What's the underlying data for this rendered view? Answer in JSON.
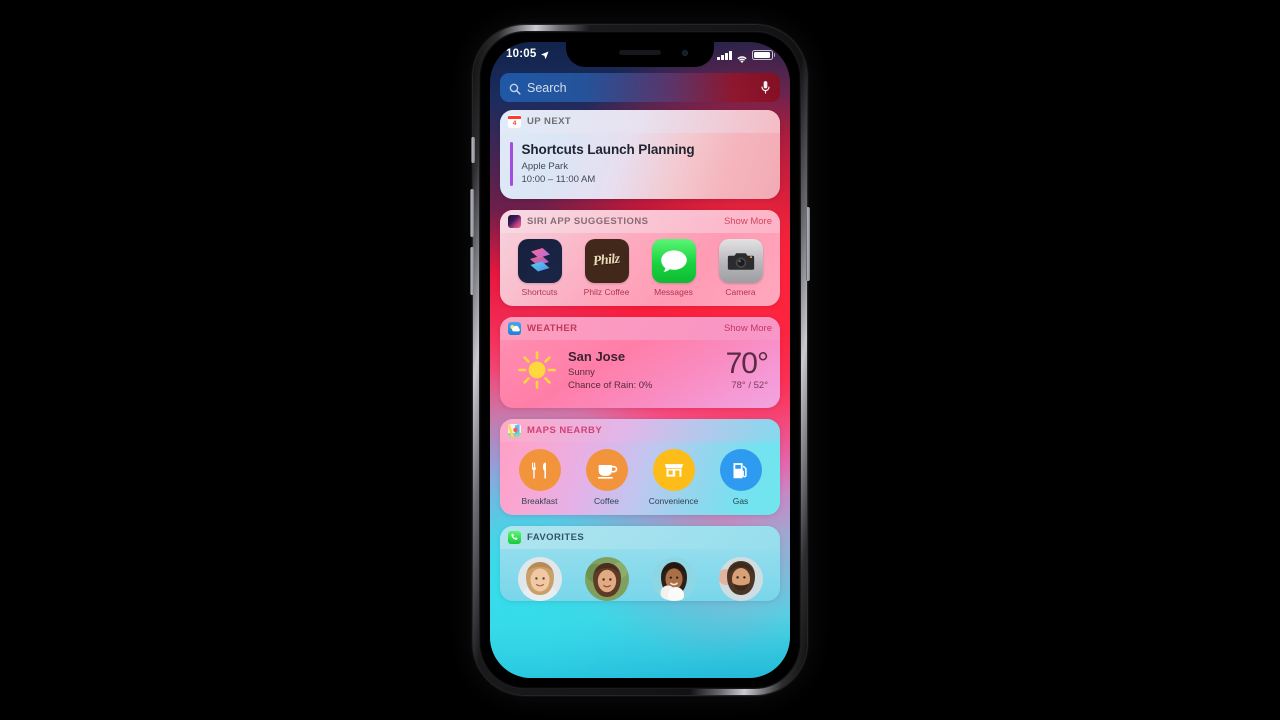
{
  "statusbar": {
    "time": "10:05",
    "location_icon": "location-arrow-icon",
    "signal_icon": "cellular-bars-icon",
    "wifi_icon": "wifi-icon",
    "battery_icon": "battery-full-icon"
  },
  "search": {
    "placeholder": "Search",
    "search_icon": "search-icon",
    "mic_icon": "microphone-icon"
  },
  "widgets": {
    "up_next": {
      "title": "UP NEXT",
      "app_icon": "calendar-icon",
      "calendar_day": "4",
      "event": {
        "title": "Shortcuts Launch Planning",
        "location": "Apple Park",
        "time": "10:00 – 11:00 AM",
        "accent_color": "#a24de0"
      }
    },
    "siri_suggestions": {
      "title": "SIRI APP SUGGESTIONS",
      "app_icon": "siri-icon",
      "show_more": "Show More",
      "apps": [
        {
          "label": "Shortcuts",
          "icon": "shortcuts-app-icon"
        },
        {
          "label": "Philz Coffee",
          "icon": "philz-coffee-app-icon",
          "wordmark": "Philz"
        },
        {
          "label": "Messages",
          "icon": "messages-app-icon"
        },
        {
          "label": "Camera",
          "icon": "camera-app-icon"
        }
      ]
    },
    "weather": {
      "title": "WEATHER",
      "app_icon": "weather-icon",
      "show_more": "Show More",
      "condition_icon": "sun-icon",
      "city": "San Jose",
      "condition": "Sunny",
      "chance_of_rain": "Chance of Rain: 0%",
      "temperature": "70°",
      "high_low": "78° / 52°"
    },
    "maps_nearby": {
      "title": "MAPS NEARBY",
      "app_icon": "maps-icon",
      "places": [
        {
          "label": "Breakfast",
          "icon": "fork-knife-icon",
          "color": "#f2943c"
        },
        {
          "label": "Coffee",
          "icon": "coffee-cup-icon",
          "color": "#f2943c"
        },
        {
          "label": "Convenience",
          "icon": "storefront-icon",
          "color": "#fdbc17"
        },
        {
          "label": "Gas",
          "icon": "fuel-pump-icon",
          "color": "#2f9bf0"
        }
      ]
    },
    "favorites": {
      "title": "FAVORITES",
      "app_icon": "phone-icon",
      "contacts": [
        {
          "avatar": "contact-avatar-1"
        },
        {
          "avatar": "contact-avatar-2"
        },
        {
          "avatar": "contact-avatar-3"
        },
        {
          "avatar": "contact-avatar-4"
        }
      ]
    }
  }
}
